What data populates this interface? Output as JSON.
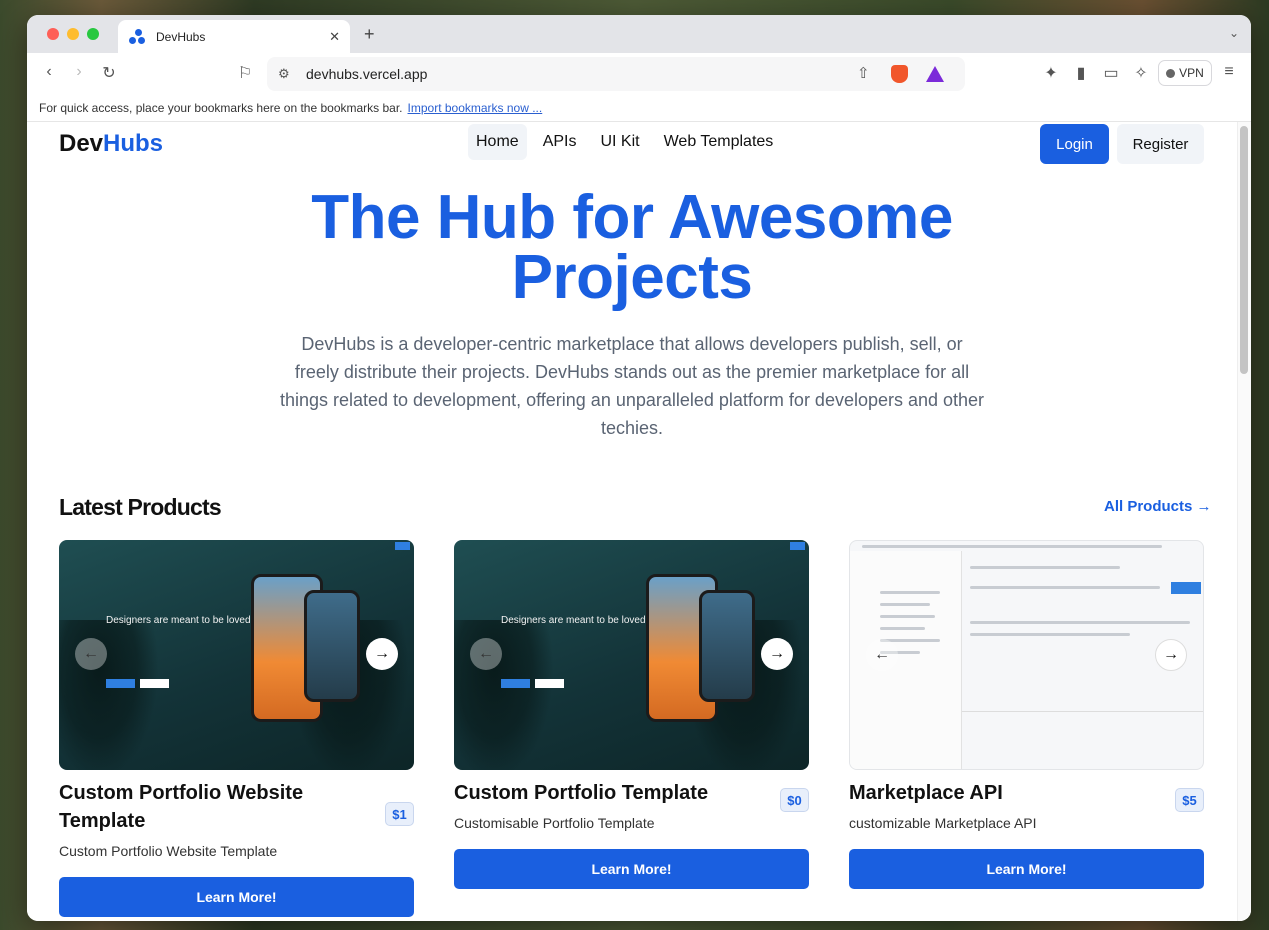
{
  "browser": {
    "tab_title": "DevHubs",
    "url": "devhubs.vercel.app",
    "vpn_label": "VPN",
    "bookmarks_hint": "For quick access, place your bookmarks here on the bookmarks bar.",
    "bookmarks_link": "Import bookmarks now ..."
  },
  "nav": {
    "logo_dev": "Dev",
    "logo_hubs": "Hubs",
    "links": [
      "Home",
      "APIs",
      "UI Kit",
      "Web Templates"
    ],
    "login": "Login",
    "register": "Register"
  },
  "hero": {
    "title": "The Hub for Awesome Projects",
    "description": "DevHubs is a developer-centric marketplace that allows developers publish, sell, or freely distribute their projects. DevHubs stands out as the premier marketplace for all things related to development, offering an unparalleled platform for developers and other techies."
  },
  "products": {
    "section_title": "Latest Products",
    "all_link": "All Products →",
    "items": [
      {
        "title": "Custom Portfolio Website Template",
        "price": "$1",
        "subtitle": "Custom Portfolio Website Template",
        "button": "Learn More!",
        "image_headline": "Designers are meant to be loved not to be understood."
      },
      {
        "title": "Custom Portfolio Template",
        "price": "$0",
        "subtitle": "Customisable Portfolio Template",
        "button": "Learn More!",
        "image_headline": "Designers are meant to be loved not to be understood."
      },
      {
        "title": "Marketplace API",
        "price": "$5",
        "subtitle": "customizable Marketplace API",
        "button": "Learn More!"
      }
    ]
  },
  "colors": {
    "accent": "#1a5fe0",
    "text": "#111111",
    "muted": "#5a6473"
  }
}
